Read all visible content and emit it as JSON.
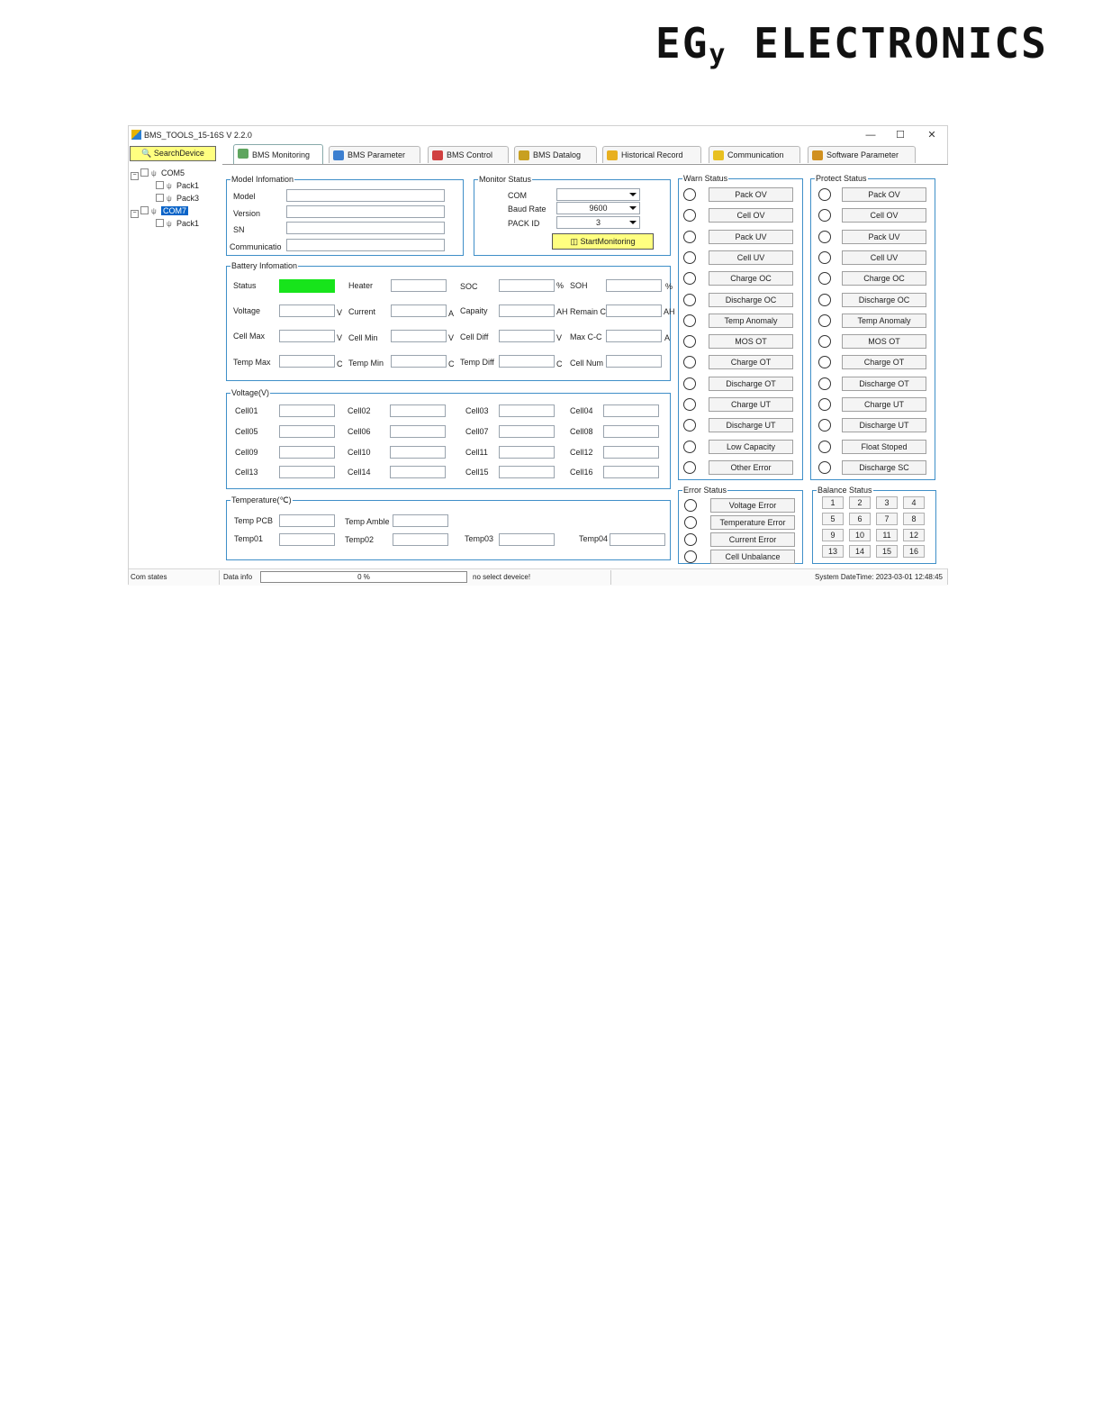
{
  "brand": {
    "prefix": "EG",
    "sub": "y",
    "suffix": " ELECTRONICS"
  },
  "window": {
    "title": "BMS_TOOLS_15-16S V 2.2.0",
    "minimize": "—",
    "maximize": "☐",
    "close": "✕"
  },
  "search_button": "SearchDevice",
  "tree": {
    "com5": "COM5",
    "com5_pack1": "Pack1",
    "com5_pack3": "Pack3",
    "com7": "COM7",
    "com7_pack1": "Pack1"
  },
  "tabs": [
    "BMS Monitoring",
    "BMS Parameter",
    "BMS Control",
    "BMS Datalog",
    "Historical Record",
    "Communication",
    "Software Parameter"
  ],
  "model_info": {
    "title": "Model Infomation",
    "labels": [
      "Model",
      "Version",
      "SN",
      "Communicatio"
    ]
  },
  "monitor_status": {
    "title": "Monitor Status",
    "com_label": "COM",
    "com_value": "",
    "baud_label": "Baud Rate",
    "baud_value": "9600",
    "pack_label": "PACK ID",
    "pack_value": "3",
    "start_button": "StartMonitoring"
  },
  "battery_info": {
    "title": "Battery Infomation",
    "status": "Status",
    "heater": "Heater",
    "soc": "SOC",
    "soc_unit": "%",
    "soh": "SOH",
    "soh_unit": "%",
    "voltage": "Voltage",
    "voltage_unit": "V",
    "current": "Current",
    "current_unit": "A",
    "capacity": "Capaity",
    "ah_remain": "AH Remain C",
    "ah_unit": "AH",
    "cell_max": "Cell Max",
    "cell_max_unit": "V",
    "cell_min": "Cell Min",
    "cell_min_unit": "V",
    "cell_diff": "Cell Diff",
    "cell_diff_unit": "V",
    "max_cc": "Max C-C",
    "max_cc_unit": "A",
    "temp_max": "Temp Max",
    "temp_max_unit": "C",
    "temp_min": "Temp Min",
    "temp_min_unit": "C",
    "temp_diff": "Temp Diff",
    "temp_diff_unit": "C",
    "cell_num": "Cell Num",
    "status_color": "#17e41b"
  },
  "voltage_group": {
    "title": "Voltage(V)",
    "cells": [
      "Cell01",
      "Cell02",
      "Cell03",
      "Cell04",
      "Cell05",
      "Cell06",
      "Cell07",
      "Cell08",
      "Cell09",
      "Cell10",
      "Cell11",
      "Cell12",
      "Cell13",
      "Cell14",
      "Cell15",
      "Cell16"
    ]
  },
  "temperature_group": {
    "title": "Temperature(℃)",
    "labels": [
      "Temp PCB",
      "Temp Amble",
      "Temp01",
      "Temp02",
      "Temp03",
      "Temp04"
    ]
  },
  "warn_status": {
    "title": "Warn Status",
    "items": [
      "Pack OV",
      "Cell OV",
      "Pack UV",
      "Cell UV",
      "Charge OC",
      "Discharge OC",
      "Temp Anomaly",
      "MOS OT",
      "Charge OT",
      "Discharge OT",
      "Charge UT",
      "Discharge UT",
      "Low Capacity",
      "Other Error"
    ]
  },
  "protect_status": {
    "title": "Protect Status",
    "items": [
      "Pack OV",
      "Cell OV",
      "Pack UV",
      "Cell UV",
      "Charge OC",
      "Discharge OC",
      "Temp Anomaly",
      "MOS OT",
      "Charge OT",
      "Discharge OT",
      "Charge UT",
      "Discharge UT",
      "Float Stoped",
      "Discharge SC"
    ]
  },
  "error_status": {
    "title": "Error Status",
    "items": [
      "Voltage Error",
      "Temperature Error",
      "Current Error",
      "Cell Unbalance"
    ]
  },
  "balance_status": {
    "title": "Balance Status",
    "items": [
      "1",
      "2",
      "3",
      "4",
      "5",
      "6",
      "7",
      "8",
      "9",
      "10",
      "11",
      "12",
      "13",
      "14",
      "15",
      "16"
    ]
  },
  "statusbar": {
    "com_states": "Com states",
    "data_info": "Data info",
    "progress_text": "0 %",
    "progress_percent": 0,
    "device_text": "no select deveice!",
    "datetime": "System DateTime: 2023-03-01 12:48:45"
  }
}
